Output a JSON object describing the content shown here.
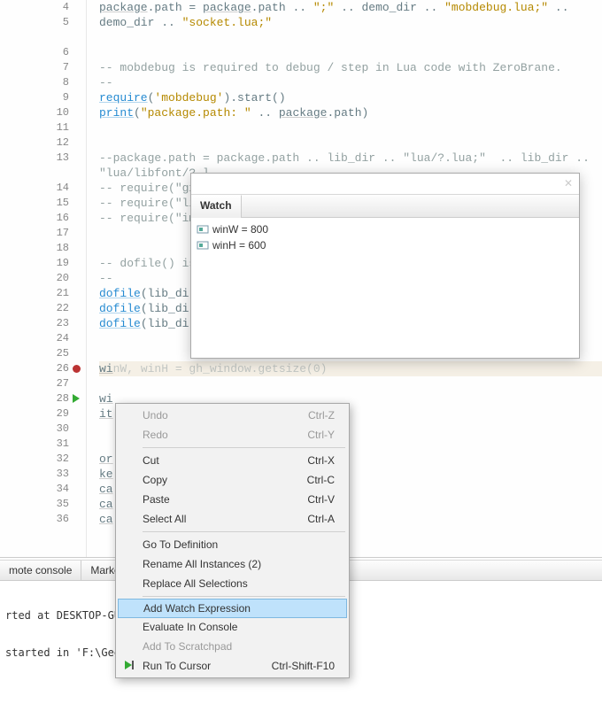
{
  "lines": [
    {
      "n": 4
    },
    {
      "n": 5
    },
    {
      "n": ""
    },
    {
      "n": 6
    },
    {
      "n": 7
    },
    {
      "n": 8
    },
    {
      "n": 9
    },
    {
      "n": 10
    },
    {
      "n": 11
    },
    {
      "n": 12
    },
    {
      "n": 13
    },
    {
      "n": ""
    },
    {
      "n": 14
    },
    {
      "n": 15
    },
    {
      "n": 16
    },
    {
      "n": 17
    },
    {
      "n": 18
    },
    {
      "n": 19
    },
    {
      "n": 20
    },
    {
      "n": 21
    },
    {
      "n": 22
    },
    {
      "n": 23
    },
    {
      "n": 24
    },
    {
      "n": 25
    },
    {
      "n": 26,
      "breakpoint": true,
      "highlight": true
    },
    {
      "n": 27
    },
    {
      "n": 28,
      "current": true
    },
    {
      "n": 29
    },
    {
      "n": 30
    },
    {
      "n": 31
    },
    {
      "n": 32
    },
    {
      "n": 33
    },
    {
      "n": 34
    },
    {
      "n": 35
    },
    {
      "n": 36
    }
  ],
  "code": {
    "5a": [
      {
        "t": "package",
        "c": "tok-var"
      },
      {
        "t": ".path = ",
        "c": "tok-id"
      },
      {
        "t": "package",
        "c": "tok-var"
      },
      {
        "t": ".path .. ",
        "c": "tok-id"
      },
      {
        "t": "\";\"",
        "c": "tok-str"
      },
      {
        "t": " .. demo_dir .. ",
        "c": "tok-id"
      },
      {
        "t": "\"mobdebug.lua;\"",
        "c": "tok-str"
      },
      {
        "t": " ..",
        "c": "tok-id"
      }
    ],
    "5b": [
      {
        "t": "demo_dir .. ",
        "c": "tok-id"
      },
      {
        "t": "\"socket.lua;\"",
        "c": "tok-str"
      }
    ],
    "7": [
      {
        "t": "-- mobdebug is required to debug / step in Lua code with ZeroBrane.",
        "c": "tok-com"
      }
    ],
    "8": [
      {
        "t": "--",
        "c": "tok-com"
      }
    ],
    "9": [
      {
        "t": "require",
        "c": "tok-fn"
      },
      {
        "t": "(",
        "c": "tok-id"
      },
      {
        "t": "'mobdebug'",
        "c": "tok-str"
      },
      {
        "t": ").start()",
        "c": "tok-id"
      }
    ],
    "10": [
      {
        "t": "print",
        "c": "tok-fn"
      },
      {
        "t": "(",
        "c": "tok-id"
      },
      {
        "t": "\"package.path: \"",
        "c": "tok-str"
      },
      {
        "t": " .. ",
        "c": "tok-id"
      },
      {
        "t": "package",
        "c": "tok-var"
      },
      {
        "t": ".path)",
        "c": "tok-id"
      }
    ],
    "13a": [
      {
        "t": "--package.path = package.path .. lib_dir .. \"lua/?.lua;\"  .. lib_dir ..",
        "c": "tok-com"
      }
    ],
    "13b": [
      {
        "t": "\"lua/libfont/?.l",
        "c": "tok-com"
      }
    ],
    "14": [
      {
        "t": "-- require(\"gx_c",
        "c": "tok-com"
      }
    ],
    "15": [
      {
        "t": "-- require(\"libf",
        "c": "tok-com"
      }
    ],
    "16": [
      {
        "t": "-- require(\"imgu",
        "c": "tok-com"
      }
    ],
    "19": [
      {
        "t": "-- dofile() is p",
        "c": "tok-com"
      }
    ],
    "20": [
      {
        "t": "--",
        "c": "tok-com"
      }
    ],
    "21": [
      {
        "t": "dofile",
        "c": "tok-fn"
      },
      {
        "t": "(lib_dir .",
        "c": "tok-id"
      }
    ],
    "22": [
      {
        "t": "dofile",
        "c": "tok-fn"
      },
      {
        "t": "(lib_dir .",
        "c": "tok-id"
      }
    ],
    "23": [
      {
        "t": "dofile",
        "c": "tok-fn"
      },
      {
        "t": "(lib_dir .",
        "c": "tok-id"
      }
    ],
    "26": [
      {
        "t": "wi",
        "c": "tok-var"
      }
    ],
    "26full": "nW, winH = gh_window.getsize(0)",
    "28": [
      {
        "t": "wi",
        "c": "tok-var"
      }
    ],
    "29": [
      {
        "t": "it",
        "c": "tok-var"
      }
    ],
    "32": [
      {
        "t": "or",
        "c": "tok-var"
      }
    ],
    "33": [
      {
        "t": "ke",
        "c": "tok-var"
      }
    ],
    "34": [
      {
        "t": "ca",
        "c": "tok-var"
      }
    ],
    "35": [
      {
        "t": "ca",
        "c": "tok-var"
      }
    ],
    "36": [
      {
        "t": "ca",
        "c": "tok-var"
      }
    ]
  },
  "watch": {
    "tab": "Watch",
    "items": [
      {
        "expr": "winW = 800"
      },
      {
        "expr": "winH = 600"
      }
    ]
  },
  "contextMenu": [
    {
      "label": "Undo",
      "shortcut": "Ctrl-Z",
      "disabled": true
    },
    {
      "label": "Redo",
      "shortcut": "Ctrl-Y",
      "disabled": true
    },
    {
      "sep": true
    },
    {
      "label": "Cut",
      "shortcut": "Ctrl-X"
    },
    {
      "label": "Copy",
      "shortcut": "Ctrl-C"
    },
    {
      "label": "Paste",
      "shortcut": "Ctrl-V"
    },
    {
      "label": "Select All",
      "shortcut": "Ctrl-A"
    },
    {
      "sep": true
    },
    {
      "label": "Go To Definition"
    },
    {
      "label": "Rename All Instances (2)"
    },
    {
      "label": "Replace All Selections"
    },
    {
      "sep": true
    },
    {
      "label": "Add Watch Expression",
      "highlight": true
    },
    {
      "label": "Evaluate In Console"
    },
    {
      "label": "Add To Scratchpad",
      "disabled": true
    },
    {
      "label": "Run To Cursor",
      "shortcut": "Ctrl-Shift-F10",
      "icon": "run"
    }
  ],
  "bottomTabs": [
    "mote console",
    "Marker"
  ],
  "console": {
    "line1": "rted at DESKTOP-GUE",
    "line2": "started in 'F:\\GeeXL"
  }
}
